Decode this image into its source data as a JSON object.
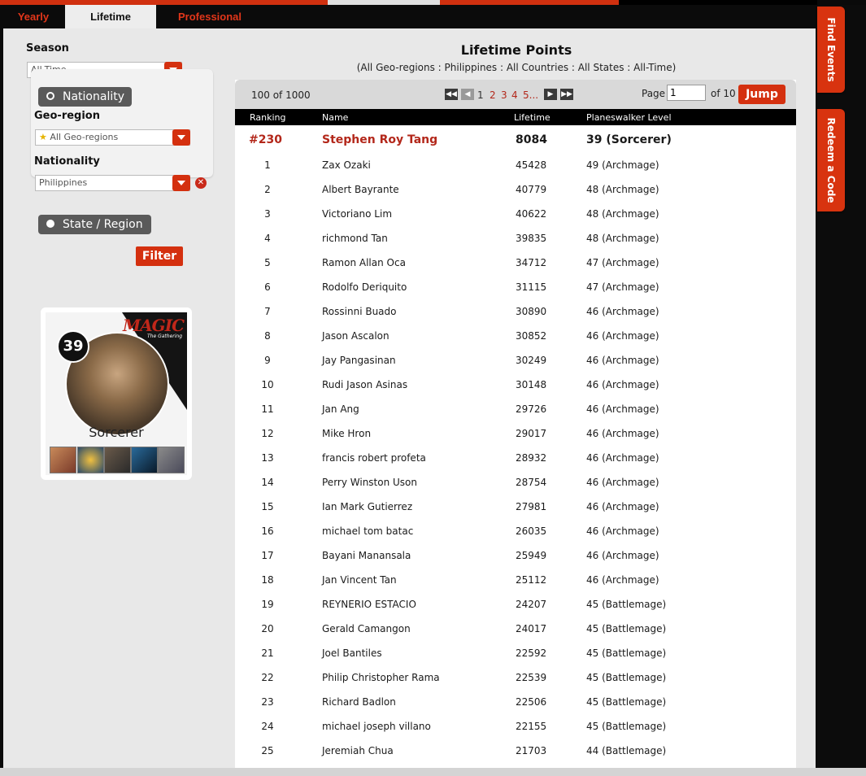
{
  "top_tabs": [
    "Yearly",
    "Lifetime",
    "Professional"
  ],
  "side_tabs": [
    "Find Events",
    "Redeem a Code"
  ],
  "filters": {
    "season_label": "Season",
    "season_value": "All-Time",
    "nationality_option": "Nationality",
    "georegion_label": "Geo-region",
    "georegion_value": "All Geo-regions",
    "nationality_label": "Nationality",
    "nationality_value": "Philippines",
    "state_option": "State / Region",
    "filter_button": "Filter"
  },
  "profile_card": {
    "logo": "MAGIC",
    "logo_sub": "The Gathering",
    "level": "39",
    "title": "Sorcerer"
  },
  "header": {
    "title": "Lifetime Points",
    "subtitle": "(All Geo-regions : Philippines : All Countries : All States : All-Time)"
  },
  "pager": {
    "count": "100 of 1000",
    "pages": [
      "1",
      "2",
      "3",
      "4",
      "5..."
    ],
    "page_label": "Page",
    "page_value": "1",
    "of_label": "of 10",
    "jump_label": "Jump"
  },
  "columns": [
    "Ranking",
    "Name",
    "Lifetime",
    "Planeswalker Level"
  ],
  "my_row": {
    "rank": "#230",
    "name": "Stephen Roy Tang",
    "points": "8084",
    "level": "39 (Sorcerer)"
  },
  "rows": [
    {
      "rank": "1",
      "name": "Zax Ozaki",
      "points": "45428",
      "level": "49 (Archmage)"
    },
    {
      "rank": "2",
      "name": "Albert Bayrante",
      "points": "40779",
      "level": "48 (Archmage)"
    },
    {
      "rank": "3",
      "name": "Victoriano Lim",
      "points": "40622",
      "level": "48 (Archmage)"
    },
    {
      "rank": "4",
      "name": "richmond Tan",
      "points": "39835",
      "level": "48 (Archmage)"
    },
    {
      "rank": "5",
      "name": "Ramon Allan Oca",
      "points": "34712",
      "level": "47 (Archmage)"
    },
    {
      "rank": "6",
      "name": "Rodolfo Deriquito",
      "points": "31115",
      "level": "47 (Archmage)"
    },
    {
      "rank": "7",
      "name": "Rossinni Buado",
      "points": "30890",
      "level": "46 (Archmage)"
    },
    {
      "rank": "8",
      "name": "Jason Ascalon",
      "points": "30852",
      "level": "46 (Archmage)"
    },
    {
      "rank": "9",
      "name": "Jay Pangasinan",
      "points": "30249",
      "level": "46 (Archmage)"
    },
    {
      "rank": "10",
      "name": "Rudi Jason Asinas",
      "points": "30148",
      "level": "46 (Archmage)"
    },
    {
      "rank": "11",
      "name": "Jan Ang",
      "points": "29726",
      "level": "46 (Archmage)"
    },
    {
      "rank": "12",
      "name": "Mike Hron",
      "points": "29017",
      "level": "46 (Archmage)"
    },
    {
      "rank": "13",
      "name": "francis robert profeta",
      "points": "28932",
      "level": "46 (Archmage)"
    },
    {
      "rank": "14",
      "name": "Perry Winston Uson",
      "points": "28754",
      "level": "46 (Archmage)"
    },
    {
      "rank": "15",
      "name": "Ian Mark Gutierrez",
      "points": "27981",
      "level": "46 (Archmage)"
    },
    {
      "rank": "16",
      "name": "michael tom batac",
      "points": "26035",
      "level": "46 (Archmage)"
    },
    {
      "rank": "17",
      "name": "Bayani Manansala",
      "points": "25949",
      "level": "46 (Archmage)"
    },
    {
      "rank": "18",
      "name": "Jan Vincent Tan",
      "points": "25112",
      "level": "46 (Archmage)"
    },
    {
      "rank": "19",
      "name": "REYNERIO ESTACIO",
      "points": "24207",
      "level": "45 (Battlemage)"
    },
    {
      "rank": "20",
      "name": "Gerald Camangon",
      "points": "24017",
      "level": "45 (Battlemage)"
    },
    {
      "rank": "21",
      "name": "Joel Bantiles",
      "points": "22592",
      "level": "45 (Battlemage)"
    },
    {
      "rank": "22",
      "name": "Philip Christopher Rama",
      "points": "22539",
      "level": "45 (Battlemage)"
    },
    {
      "rank": "23",
      "name": "Richard Badlon",
      "points": "22506",
      "level": "45 (Battlemage)"
    },
    {
      "rank": "24",
      "name": "michael joseph villano",
      "points": "22155",
      "level": "45 (Battlemage)"
    },
    {
      "rank": "25",
      "name": "Jeremiah Chua",
      "points": "21703",
      "level": "44 (Battlemage)"
    }
  ],
  "colors": {
    "accent": "#d4300f",
    "highlight_text": "#b3271a",
    "panel": "#e8e8e8",
    "header_bg": "#000000"
  }
}
